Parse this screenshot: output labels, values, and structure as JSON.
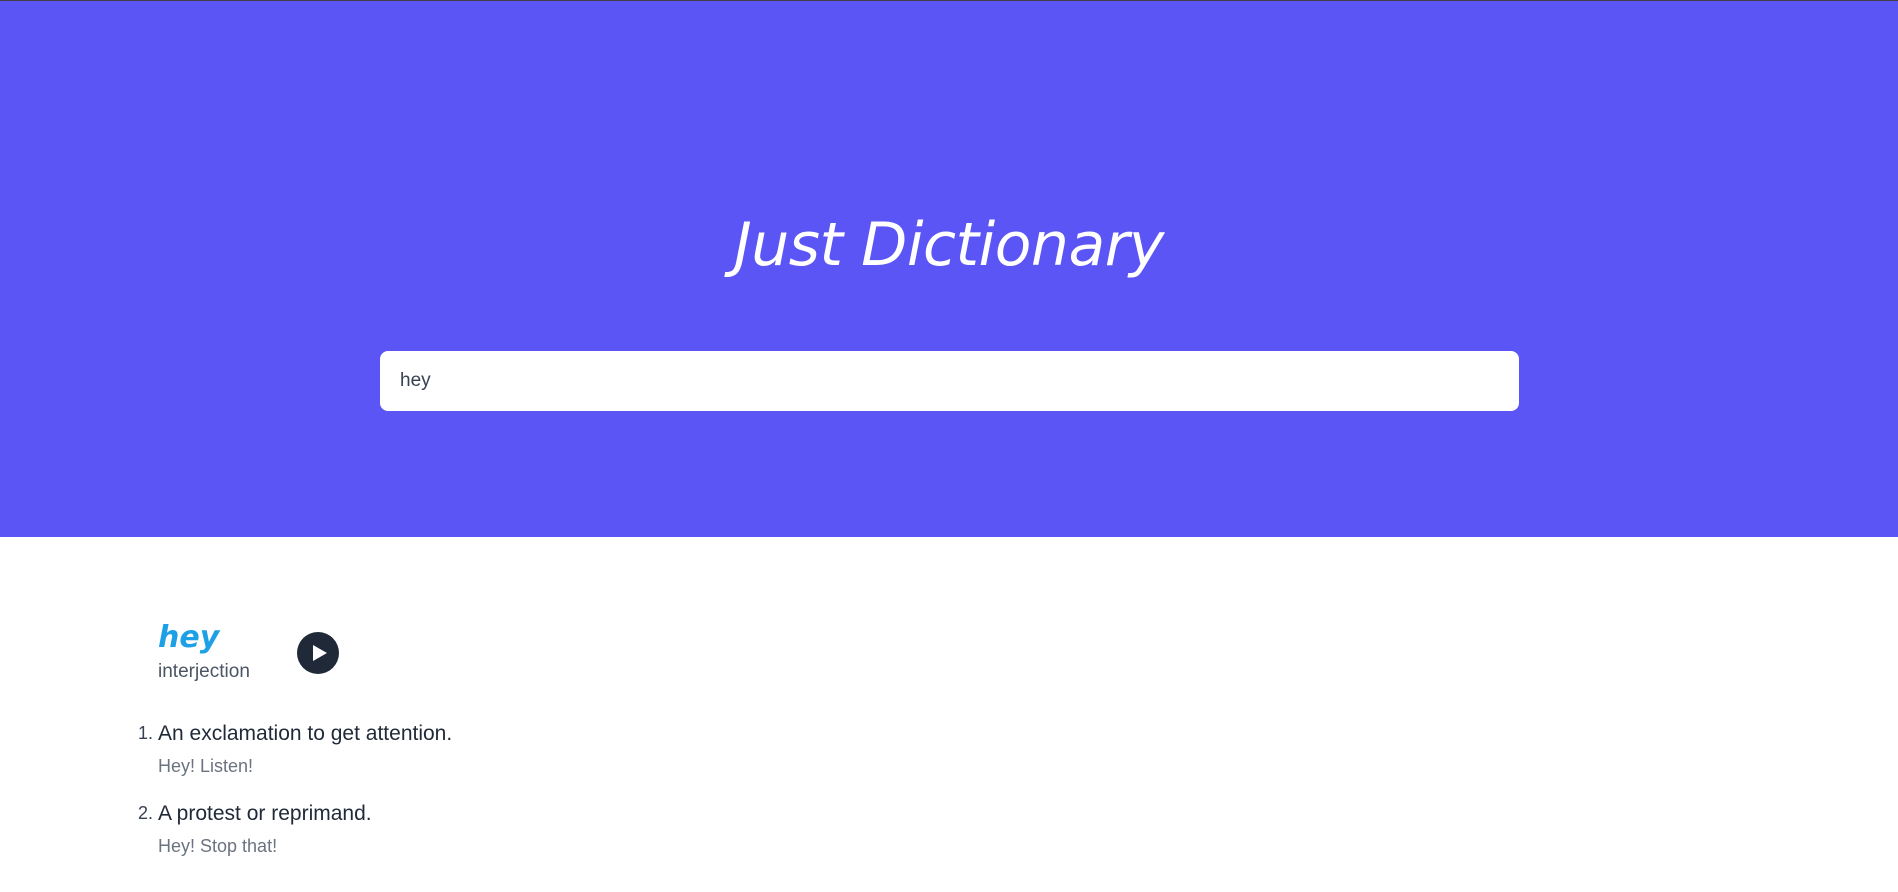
{
  "header": {
    "title": "Just Dictionary",
    "accent_color": "#5b55f6"
  },
  "search": {
    "value": "hey",
    "placeholder": ""
  },
  "entry": {
    "word": "hey",
    "part_of_speech": "interjection",
    "play_icon": "play-icon",
    "definitions": [
      {
        "text": "An exclamation to get attention.",
        "example": "Hey! Listen!"
      },
      {
        "text": "A protest or reprimand.",
        "example": "Hey! Stop that!"
      }
    ]
  }
}
